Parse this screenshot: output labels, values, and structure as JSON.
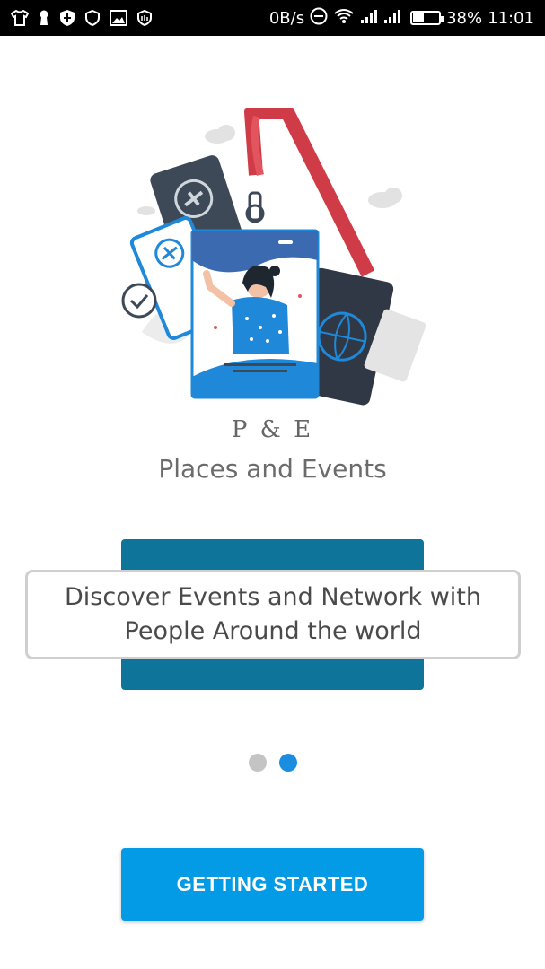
{
  "status_bar": {
    "net_speed": "0B/s",
    "battery_percent": "38%",
    "battery_level": 0.38,
    "time": "11:01",
    "icons": [
      "shirt-icon",
      "keyhole-icon",
      "shield-icon",
      "shield-outline-icon",
      "image-icon",
      "shield-badge-icon",
      "dnd-icon",
      "wifi-icon",
      "signal-icon",
      "signal-icon-2",
      "battery-icon"
    ]
  },
  "brand": {
    "logo_text": "P & E",
    "app_name": "Places and Events"
  },
  "onboarding": {
    "message": "Discover Events and Network with People Around the world",
    "pages": 2,
    "active_page": 2
  },
  "cta": {
    "label": "GETTING STARTED"
  },
  "colors": {
    "accent": "#049be6",
    "banner": "#0e7499",
    "dot_active": "#1a8de0",
    "dot_inactive": "#c4c4c4"
  }
}
